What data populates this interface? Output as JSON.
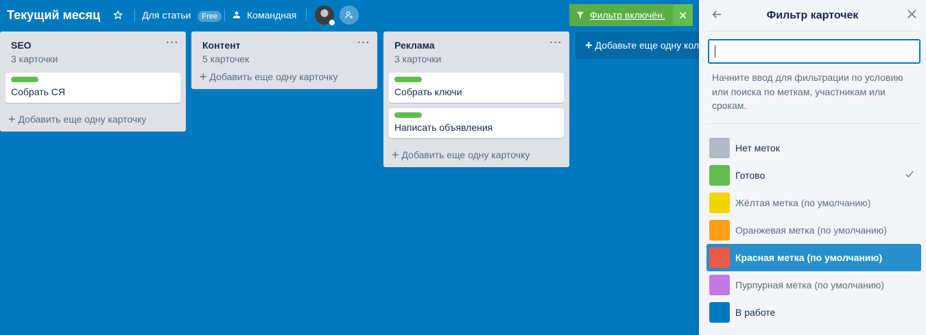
{
  "header": {
    "board_title": "Текущий месяц",
    "workspace": "Для статьи",
    "plan_badge": "Free",
    "visibility": "Командная",
    "filter_label": "Фильтр включён."
  },
  "lists": [
    {
      "title": "SEO",
      "count": "3 карточки",
      "cards": [
        {
          "text": "Собрать СЯ",
          "label_color": "#61bd4f"
        }
      ],
      "add_card": "Добавить еще одну карточку"
    },
    {
      "title": "Контент",
      "count": "5 карточек",
      "cards": [],
      "add_card": "Добавить еще одну карточку"
    },
    {
      "title": "Реклама",
      "count": "3 карточки",
      "cards": [
        {
          "text": "Собрать ключи",
          "label_color": "#61bd4f"
        },
        {
          "text": "Написать объявления",
          "label_color": "#61bd4f"
        }
      ],
      "add_card": "Добавить еще одну карточку"
    }
  ],
  "add_list": "Добавьте еще одну колонку",
  "panel": {
    "title": "Фильтр карточек",
    "search_value": "",
    "hint": "Начните ввод для фильтрации по условию или поиска по меткам, участникам или срокам.",
    "labels": [
      {
        "name": "Нет меток",
        "color": "#b3bac5",
        "checked": false,
        "active": false,
        "muted": false
      },
      {
        "name": "Готово",
        "color": "#61bd4f",
        "checked": true,
        "active": false,
        "muted": false
      },
      {
        "name": "Жёлтая метка (по умолчанию)",
        "color": "#f2d600",
        "checked": false,
        "active": false,
        "muted": true
      },
      {
        "name": "Оранжевая метка (по умолчанию)",
        "color": "#ff9f1a",
        "checked": false,
        "active": false,
        "muted": true
      },
      {
        "name": "Красная метка (по умолчанию)",
        "color": "#eb5a46",
        "checked": false,
        "active": true,
        "muted": false
      },
      {
        "name": "Пурпурная метка (по умолчанию)",
        "color": "#c377e0",
        "checked": false,
        "active": false,
        "muted": true
      },
      {
        "name": "В работе",
        "color": "#0079bf",
        "checked": false,
        "active": false,
        "muted": false
      }
    ]
  }
}
